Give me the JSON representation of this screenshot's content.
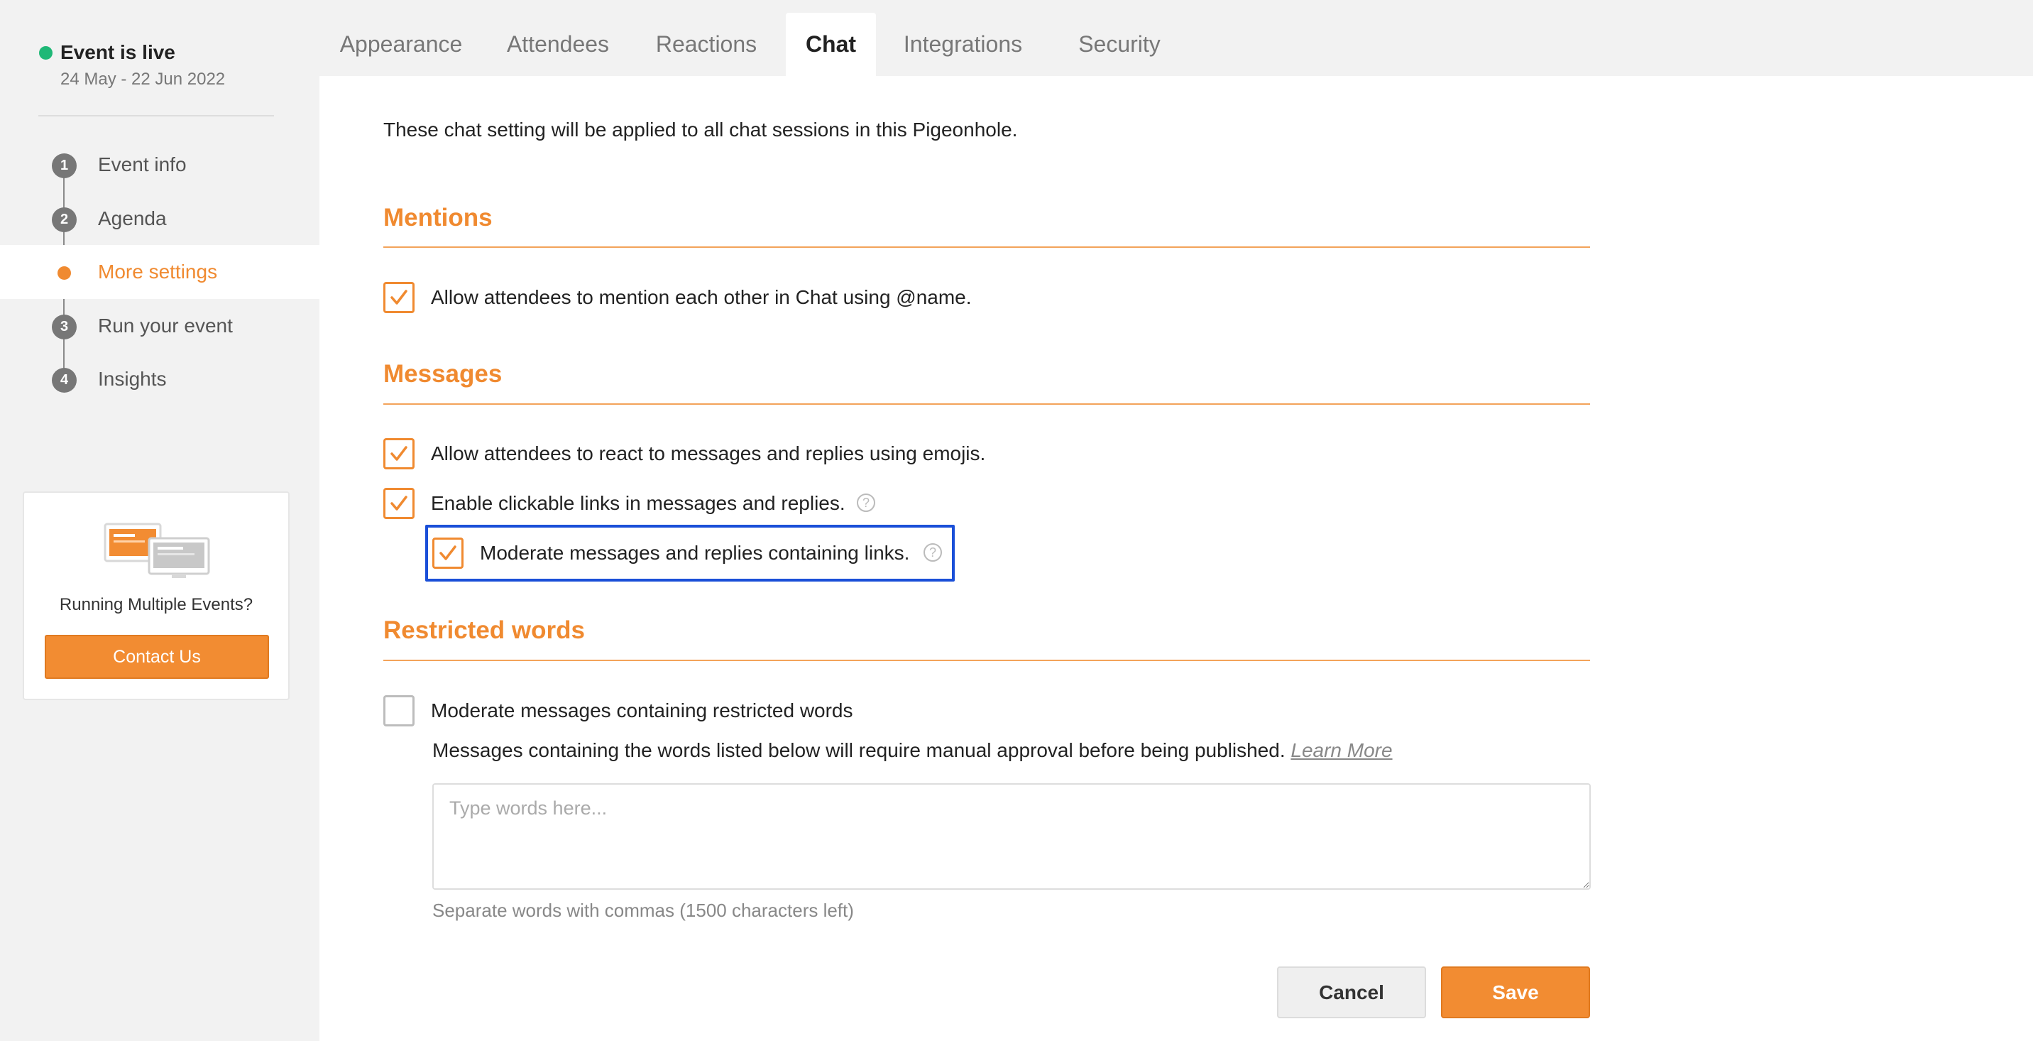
{
  "status": {
    "title": "Event is live",
    "dates": "24 May - 22 Jun 2022"
  },
  "steps": [
    {
      "badge": "1",
      "label": "Event info"
    },
    {
      "badge": "2",
      "label": "Agenda"
    },
    {
      "badge": "",
      "label": "More settings"
    },
    {
      "badge": "3",
      "label": "Run your event"
    },
    {
      "badge": "4",
      "label": "Insights"
    }
  ],
  "promo": {
    "text": "Running Multiple Events?",
    "button": "Contact Us"
  },
  "tabs": [
    "Appearance",
    "Attendees",
    "Reactions",
    "Chat",
    "Integrations",
    "Security"
  ],
  "active_tab": "Chat",
  "intro": "These chat setting will be applied to all chat sessions in this Pigeonhole.",
  "mentions": {
    "title": "Mentions",
    "option": "Allow attendees to mention each other in Chat using @name."
  },
  "messages": {
    "title": "Messages",
    "react": "Allow attendees to react to messages and replies using emojis.",
    "links": "Enable clickable links in messages and replies.",
    "moderate_links": "Moderate messages and replies containing links."
  },
  "restricted": {
    "title": "Restricted words",
    "option": "Moderate messages containing restricted words",
    "description": "Messages containing the words listed below will require manual approval before being published.",
    "learn_more": "Learn More",
    "placeholder": "Type words here...",
    "hint": "Separate words with commas (1500 characters left)"
  },
  "help_glyph": "?",
  "actions": {
    "cancel": "Cancel",
    "save": "Save"
  },
  "colors": {
    "accent": "#f08a30",
    "live": "#1fb877",
    "focus": "#1a4fd8"
  }
}
